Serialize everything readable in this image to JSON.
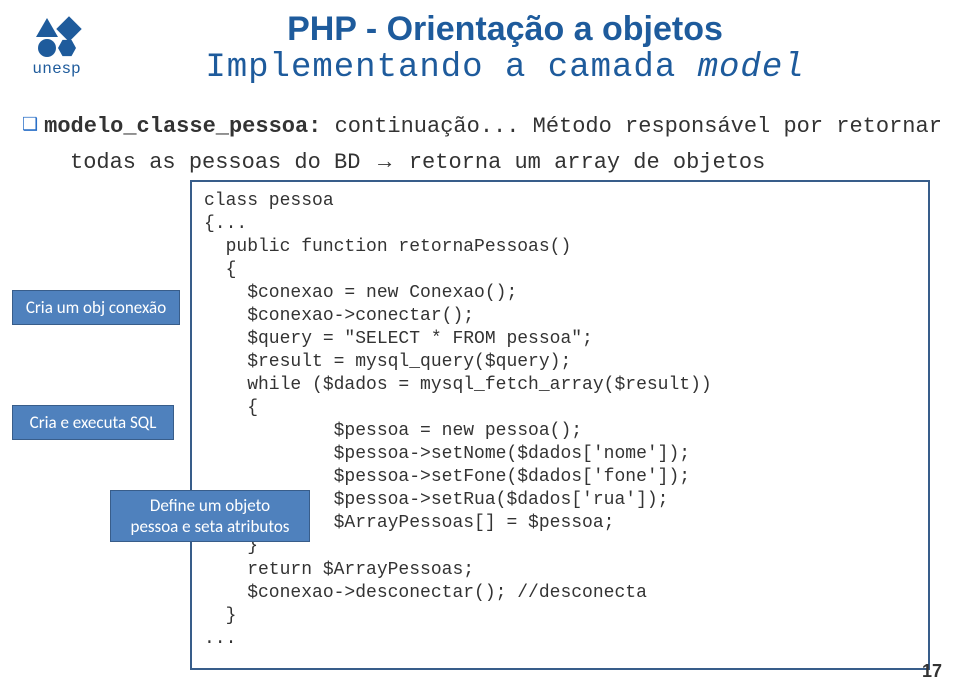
{
  "logo": {
    "text": "unesp"
  },
  "header": {
    "line1": "PHP - Orientação a objetos",
    "line2_a": "Implementando a camada ",
    "line2_b": "model"
  },
  "subtitle": {
    "bullet": "❑",
    "bold": "modelo_classe_pessoa:",
    "rest": " continuação... Método responsável por retornar"
  },
  "subtitle2_a": "todas as pessoas do BD ",
  "subtitle2_arrow": "→",
  "subtitle2_b": " retorna um array de objetos",
  "annotations": {
    "conexao": "Cria um obj conexão",
    "sql": "Cria e executa SQL",
    "objeto_l1": "Define um objeto",
    "objeto_l2": "pessoa e seta atributos"
  },
  "code": "class pessoa\n{...\n  public function retornaPessoas()\n  {\n    $conexao = new Conexao();\n    $conexao->conectar();\n    $query = \"SELECT * FROM pessoa\";\n    $result = mysql_query($query);\n    while ($dados = mysql_fetch_array($result))\n    {\n            $pessoa = new pessoa();\n            $pessoa->setNome($dados['nome']);\n            $pessoa->setFone($dados['fone']);\n            $pessoa->setRua($dados['rua']);\n            $ArrayPessoas[] = $pessoa;\n    }\n    return $ArrayPessoas;\n    $conexao->desconectar(); //desconecta\n  }\n...",
  "page_number": "17"
}
